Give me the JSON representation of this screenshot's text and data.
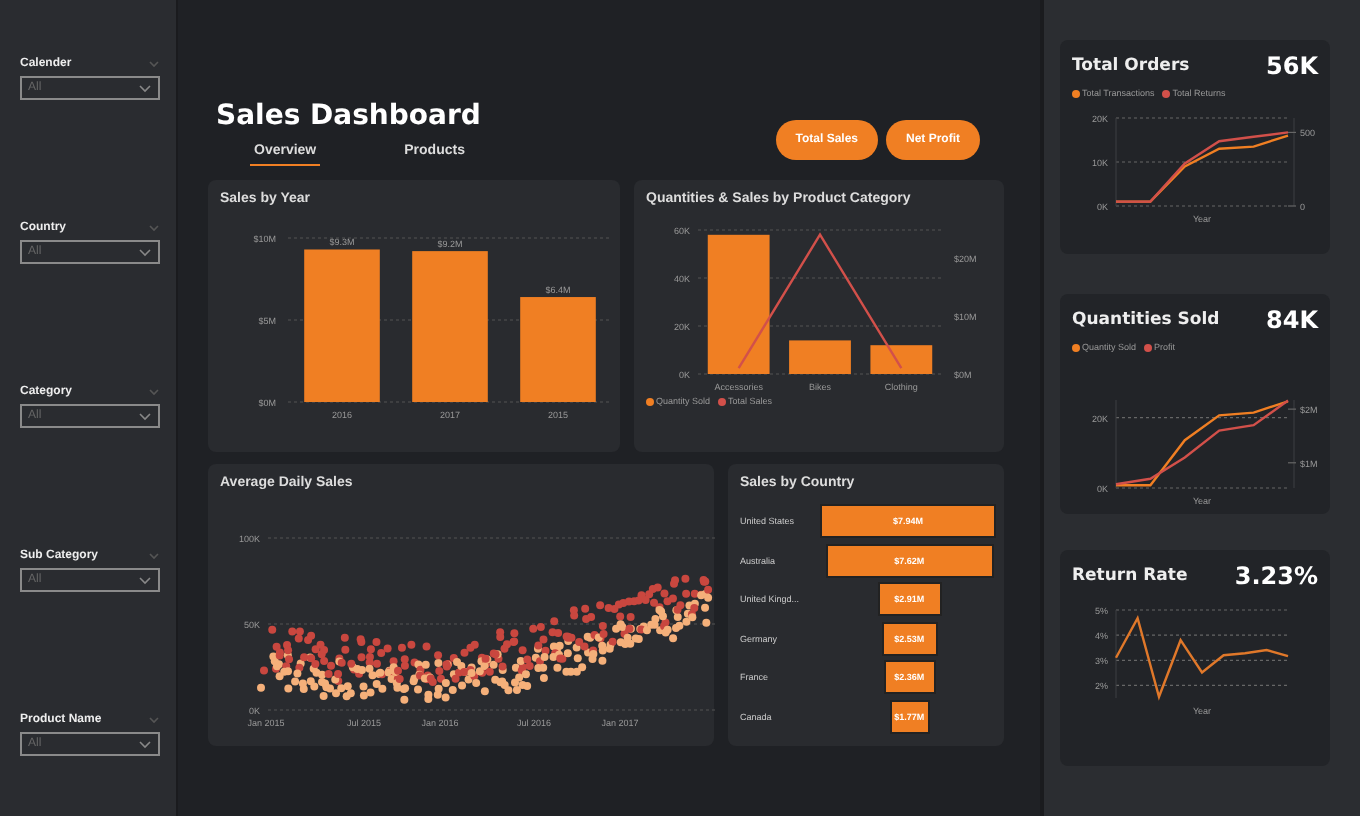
{
  "sidebar": {
    "slicers": [
      {
        "label": "Calender",
        "value": "All"
      },
      {
        "label": "Country",
        "value": "All"
      },
      {
        "label": "Category",
        "value": "All"
      },
      {
        "label": "Sub Category",
        "value": "All"
      },
      {
        "label": "Product Name",
        "value": "All"
      }
    ]
  },
  "header": {
    "title": "Sales Dashboard",
    "tabs": [
      {
        "label": "Overview",
        "selected": true
      },
      {
        "label": "Products",
        "selected": false
      }
    ],
    "buttons": [
      "Total Sales",
      "Net Profit"
    ]
  },
  "sales_by_year": {
    "title": "Sales by Year",
    "chart_data": {
      "type": "bar",
      "categories": [
        "2016",
        "2017",
        "2015"
      ],
      "values": [
        9.3,
        9.2,
        6.4
      ],
      "ylim": [
        0,
        10
      ],
      "yticks": [
        {
          "value": 0,
          "label": "$0M"
        },
        {
          "value": 5,
          "label": "$5M"
        },
        {
          "value": 10,
          "label": "$10M"
        }
      ],
      "value_labels": [
        "$9.3M",
        "$9.2M",
        "$6.4M"
      ]
    }
  },
  "category_chart": {
    "title": "Quantities & Sales by Product Category",
    "chart_data": {
      "type": "bar",
      "categories": [
        "Accessories",
        "Bikes",
        "Clothing"
      ],
      "series": [
        {
          "name": "Quantity Sold",
          "type": "bar",
          "color": "#f07f23",
          "values": [
            58000,
            14000,
            12000
          ]
        },
        {
          "name": "Total Sales",
          "type": "line",
          "axis": "y2",
          "color": "#d2504a",
          "values": [
            1,
            24,
            1
          ]
        }
      ],
      "ylim": [
        0,
        60000
      ],
      "yticks": [
        {
          "value": 0,
          "label": "0K"
        },
        {
          "value": 20000,
          "label": "20K"
        },
        {
          "value": 40000,
          "label": "40K"
        },
        {
          "value": 60000,
          "label": "60K"
        }
      ],
      "y2lim": [
        0,
        24.8
      ],
      "y2ticks": [
        {
          "value": 0,
          "label": "$0M"
        },
        {
          "value": 10,
          "label": "$10M"
        },
        {
          "value": 20,
          "label": "$20M"
        }
      ]
    }
  },
  "daily_sales": {
    "title": "Average Daily Sales",
    "y_ticks": [
      "100K",
      "50K",
      "0K"
    ],
    "x_ticks": [
      "Jan 2015",
      "Jul 2015",
      "Jan 2016",
      "Jul 2016",
      "Jan 2017"
    ]
  },
  "country_chart": {
    "title": "Sales by Country",
    "rows": [
      {
        "country": "United States",
        "sales": "$7.94M"
      },
      {
        "country": "Australia",
        "sales": "$7.62M"
      },
      {
        "country": "United Kingd...",
        "sales": "$2.91M"
      },
      {
        "country": "Germany",
        "sales": "$2.53M"
      },
      {
        "country": "France",
        "sales": "$2.36M"
      },
      {
        "country": "Canada",
        "sales": "$1.77M"
      }
    ]
  },
  "kpis": [
    {
      "title": "Total Orders",
      "value": "56K",
      "chart_data": {
        "type": "line",
        "xlabel": "Year",
        "grid": true,
        "ylim": [
          0,
          20000
        ],
        "y2lim": [
          0,
          598
        ],
        "yticks": [
          {
            "value": 0,
            "label": "0K"
          },
          {
            "value": 10000,
            "label": "10K"
          },
          {
            "value": 20000,
            "label": "20K"
          }
        ],
        "y2ticks": [
          {
            "value": 0,
            "label": "0"
          },
          {
            "value": 500,
            "label": "500"
          }
        ],
        "series": [
          {
            "name": "Total Transactions",
            "color": "#f07f23",
            "values": [
              1000,
              1000,
              9000,
              13000,
              13500,
              16000
            ]
          },
          {
            "name": "Total Returns",
            "color": "#d2504a",
            "axis": "y2",
            "values": [
              30,
              30,
              290,
              440,
              470,
              500
            ]
          }
        ]
      }
    },
    {
      "title": "Quantities Sold",
      "value": "84K",
      "chart_data": {
        "type": "line",
        "xlabel": "Year",
        "grid": true,
        "ylim": [
          0,
          25000
        ],
        "y2lim": [
          0.53,
          2.17
        ],
        "yticks": [
          {
            "value": 0,
            "label": "0K"
          },
          {
            "value": 20000,
            "label": "20K"
          }
        ],
        "y2ticks": [
          {
            "value": 1,
            "label": "$1M"
          },
          {
            "value": 2,
            "label": "$2M"
          }
        ],
        "series": [
          {
            "name": "Quantity Sold",
            "color": "#f07f23",
            "values": [
              800,
              800,
              13600,
              20600,
              21400,
              24600
            ]
          },
          {
            "name": "Profit",
            "color": "#d2504a",
            "axis": "y2",
            "values": [
              0.6,
              0.7,
              1.1,
              1.6,
              1.7,
              2.16
            ]
          }
        ]
      }
    },
    {
      "title": "Return Rate",
      "value": "3.23%",
      "chart_data": {
        "type": "line",
        "xlabel": "Year",
        "grid": true,
        "ylim": [
          1.5,
          5
        ],
        "yticks": [
          {
            "value": 2,
            "label": "2%"
          },
          {
            "value": 3,
            "label": "3%"
          },
          {
            "value": 4,
            "label": "4%"
          },
          {
            "value": 5,
            "label": "5%"
          }
        ],
        "series": [
          {
            "color": "#e0782a",
            "values": [
              3.1,
              4.67,
              1.55,
              3.8,
              2.52,
              3.2,
              3.28,
              3.41,
              3.16
            ]
          }
        ]
      }
    }
  ]
}
